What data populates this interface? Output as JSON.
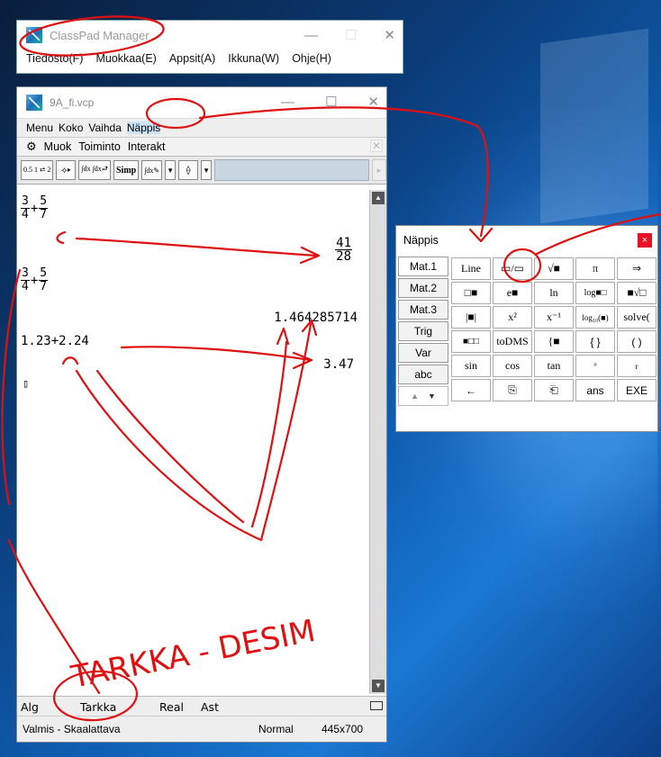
{
  "mainwin": {
    "title": "ClassPad Manager",
    "menu": [
      "Tiedosto(F)",
      "Muokkaa(E)",
      "Appsit(A)",
      "Ikkuna(W)",
      "Ohje(H)"
    ],
    "buttons": {
      "minimize": "—",
      "maximize": "☐",
      "close": "✕"
    }
  },
  "vcp": {
    "title": "9A_fi.vcp",
    "menu": [
      "Menu",
      "Koko",
      "Vaihda",
      "Näppis"
    ],
    "submenu": [
      "Muok",
      "Toiminto",
      "Interakt"
    ],
    "toolbar": [
      "0.5 1 ⮂ 2",
      "⟡▸",
      "∫dx ∫dx⮐",
      "Simp",
      "∫dx✎",
      "▾",
      "⟠",
      "▾"
    ],
    "work": {
      "expr1": {
        "n1": "3",
        "d1": "4",
        "op": "+",
        "n2": "5",
        "d2": "7"
      },
      "result1": {
        "num": "41",
        "den": "28"
      },
      "expr2": {
        "n1": "3",
        "d1": "4",
        "op": "+",
        "n2": "5",
        "d2": "7"
      },
      "result2": "1.464285714",
      "expr3": "1.23+2.24",
      "result3": "3.47",
      "cursor": "▯"
    },
    "status1": {
      "alg": "Alg",
      "mode": "Tarkka",
      "real": "Real",
      "ast": "Ast"
    },
    "status2": {
      "state": "Valmis - Skaalattava",
      "view": "Normal",
      "size": "445x700"
    }
  },
  "nappis": {
    "title": "Näppis",
    "close": "×",
    "tabs": [
      "Mat.1",
      "Mat.2",
      "Mat.3",
      "Trig",
      "Var",
      "abc"
    ],
    "keys": [
      "Line",
      "▭/▭",
      "√■",
      "π",
      "⇒",
      "□■",
      "e■",
      "ln",
      "log■□",
      "■√□",
      "|■|",
      "x²",
      "x⁻¹",
      "log₁₀(■)",
      "solve(",
      "■□□",
      "toDMS",
      "{■",
      "{ }",
      "( )",
      "sin",
      "cos",
      "tan",
      "°",
      "r",
      "←",
      "⎘",
      "⎗",
      "ans",
      "EXE"
    ]
  },
  "annotation_text": "TARKKA - DESIM"
}
